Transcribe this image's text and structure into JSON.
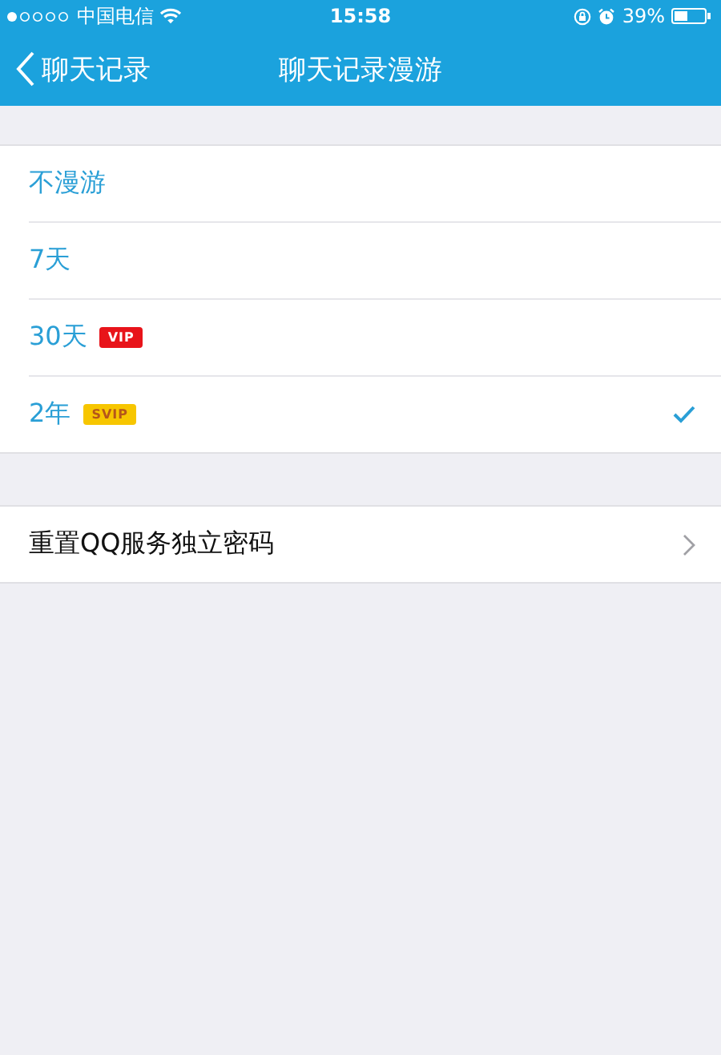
{
  "status_bar": {
    "carrier": "中国电信",
    "time": "15:58",
    "battery": "39%"
  },
  "nav_bar": {
    "back": "聊天记录",
    "title": "聊天记录漫游"
  },
  "options": [
    {
      "label": "不漫游",
      "selected": false
    },
    {
      "label": "7天",
      "selected": false
    },
    {
      "label": "30天",
      "selected": false,
      "badge": {
        "text": "VIP",
        "kind": "vip"
      }
    },
    {
      "label": "2年",
      "selected": true,
      "badge": {
        "text": "SVIP",
        "kind": "svip"
      }
    }
  ],
  "actions": [
    {
      "label": "重置QQ服务独立密码"
    }
  ]
}
